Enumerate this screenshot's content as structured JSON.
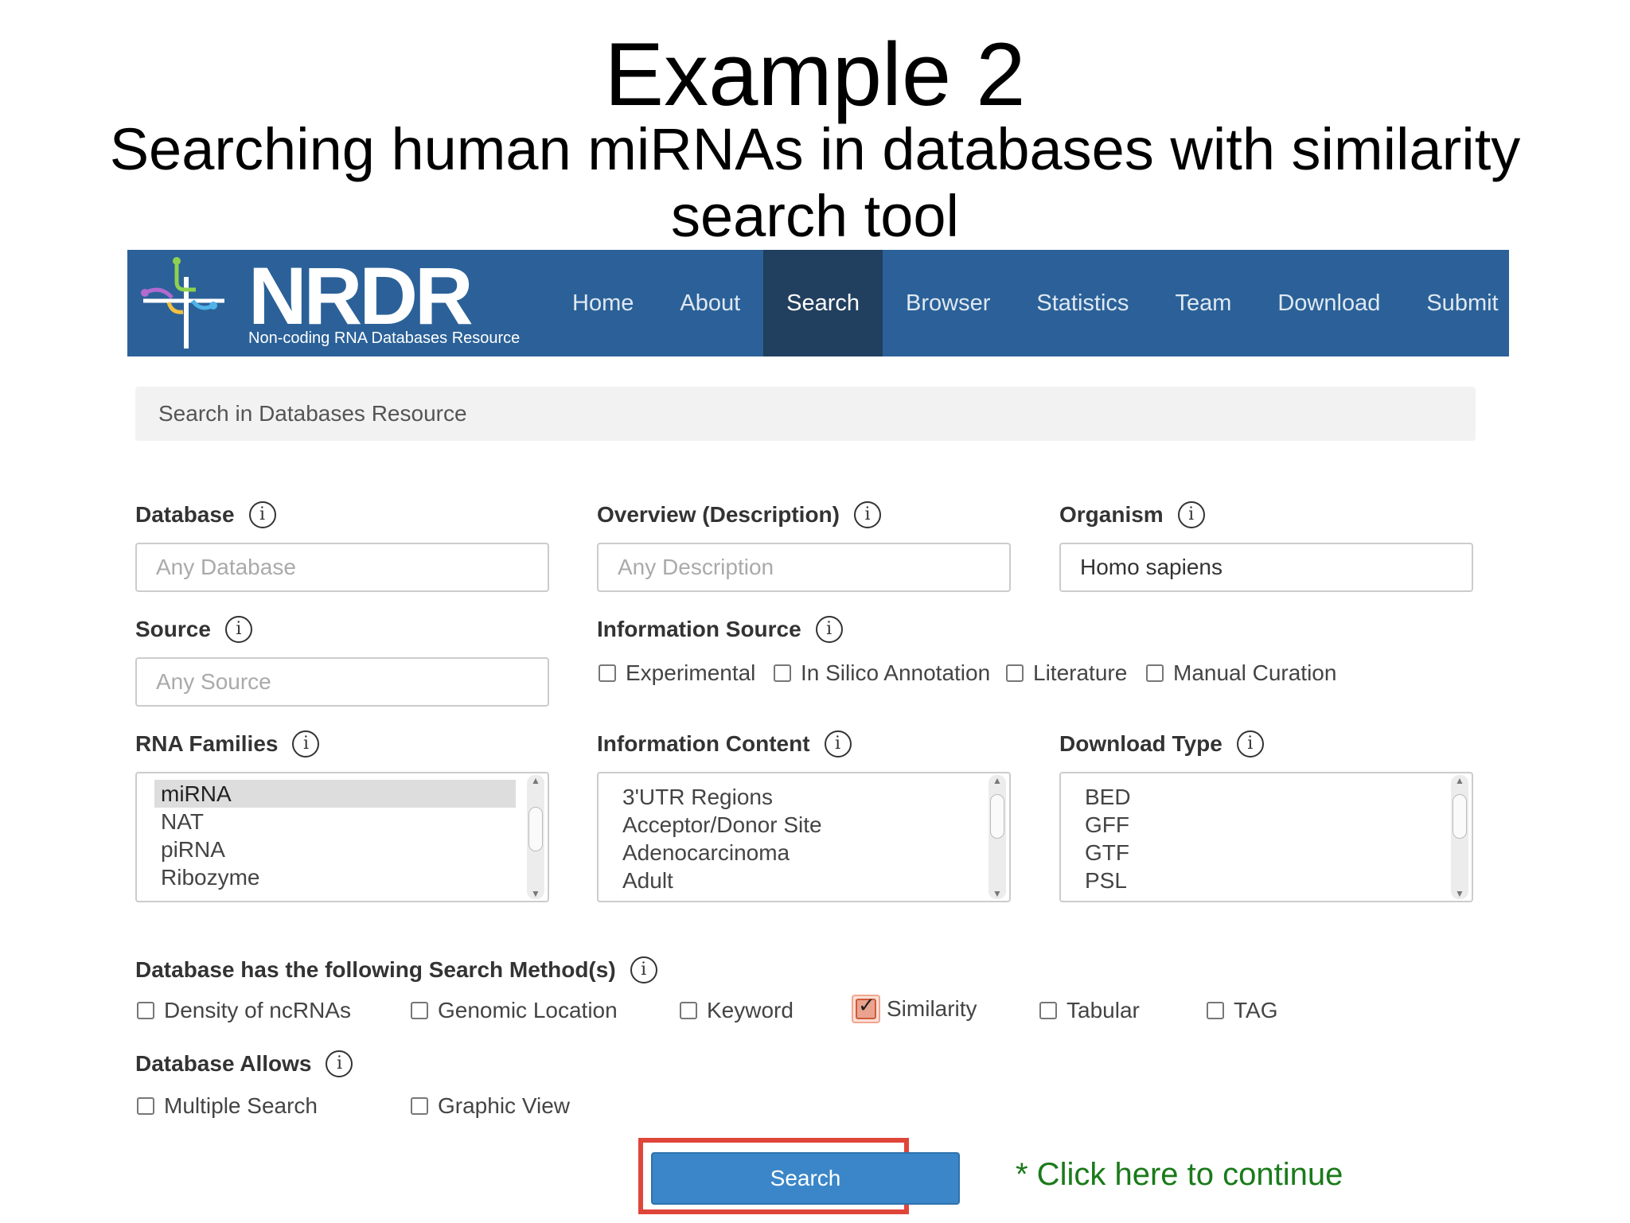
{
  "slide": {
    "title": "Example 2",
    "subtitle": "Searching human miRNAs in databases with similarity search tool"
  },
  "brand": {
    "name": "NRDR",
    "tagline": "Non-coding RNA Databases Resource"
  },
  "nav": {
    "items": [
      "Home",
      "About",
      "Search",
      "Browser",
      "Statistics",
      "Team",
      "Download",
      "Submit"
    ],
    "active": "Search"
  },
  "search_header": "Search in Databases Resource",
  "fields": {
    "database": {
      "label": "Database",
      "placeholder": "Any Database",
      "value": ""
    },
    "overview": {
      "label": "Overview (Description)",
      "placeholder": "Any Description",
      "value": ""
    },
    "organism": {
      "label": "Organism",
      "placeholder": "",
      "value": "Homo sapiens"
    },
    "source": {
      "label": "Source",
      "placeholder": "Any Source",
      "value": ""
    }
  },
  "information_source": {
    "label": "Information Source",
    "options": [
      "Experimental",
      "In Silico Annotation",
      "Literature",
      "Manual Curation"
    ]
  },
  "rna_families": {
    "label": "RNA Families",
    "options_visible": [
      "miRNA",
      "NAT",
      "piRNA",
      "Ribozyme"
    ],
    "selected": "miRNA"
  },
  "information_content": {
    "label": "Information Content",
    "options_visible": [
      "3'UTR Regions",
      "Acceptor/Donor Site",
      "Adenocarcinoma",
      "Adult"
    ]
  },
  "download_type": {
    "label": "Download Type",
    "options_visible": [
      "BED",
      "GFF",
      "GTF",
      "PSL"
    ]
  },
  "search_methods": {
    "label": "Database has the following Search Method(s)",
    "options": [
      {
        "label": "Density of ncRNAs",
        "checked": false
      },
      {
        "label": "Genomic Location",
        "checked": false
      },
      {
        "label": "Keyword",
        "checked": false
      },
      {
        "label": "Similarity",
        "checked": true
      },
      {
        "label": "Tabular",
        "checked": false
      },
      {
        "label": "TAG",
        "checked": false
      }
    ]
  },
  "database_allows": {
    "label": "Database Allows",
    "options": [
      "Multiple Search",
      "Graphic View"
    ]
  },
  "submit_button": "Search",
  "continue_note": "* Click here to continue",
  "info_icon_glyph": "i",
  "colors": {
    "navbar": "#2b6198",
    "nav_active": "#213f5e",
    "button": "#3a86c8",
    "highlight_box": "#e0453a",
    "note_text": "#1a7a1a"
  }
}
